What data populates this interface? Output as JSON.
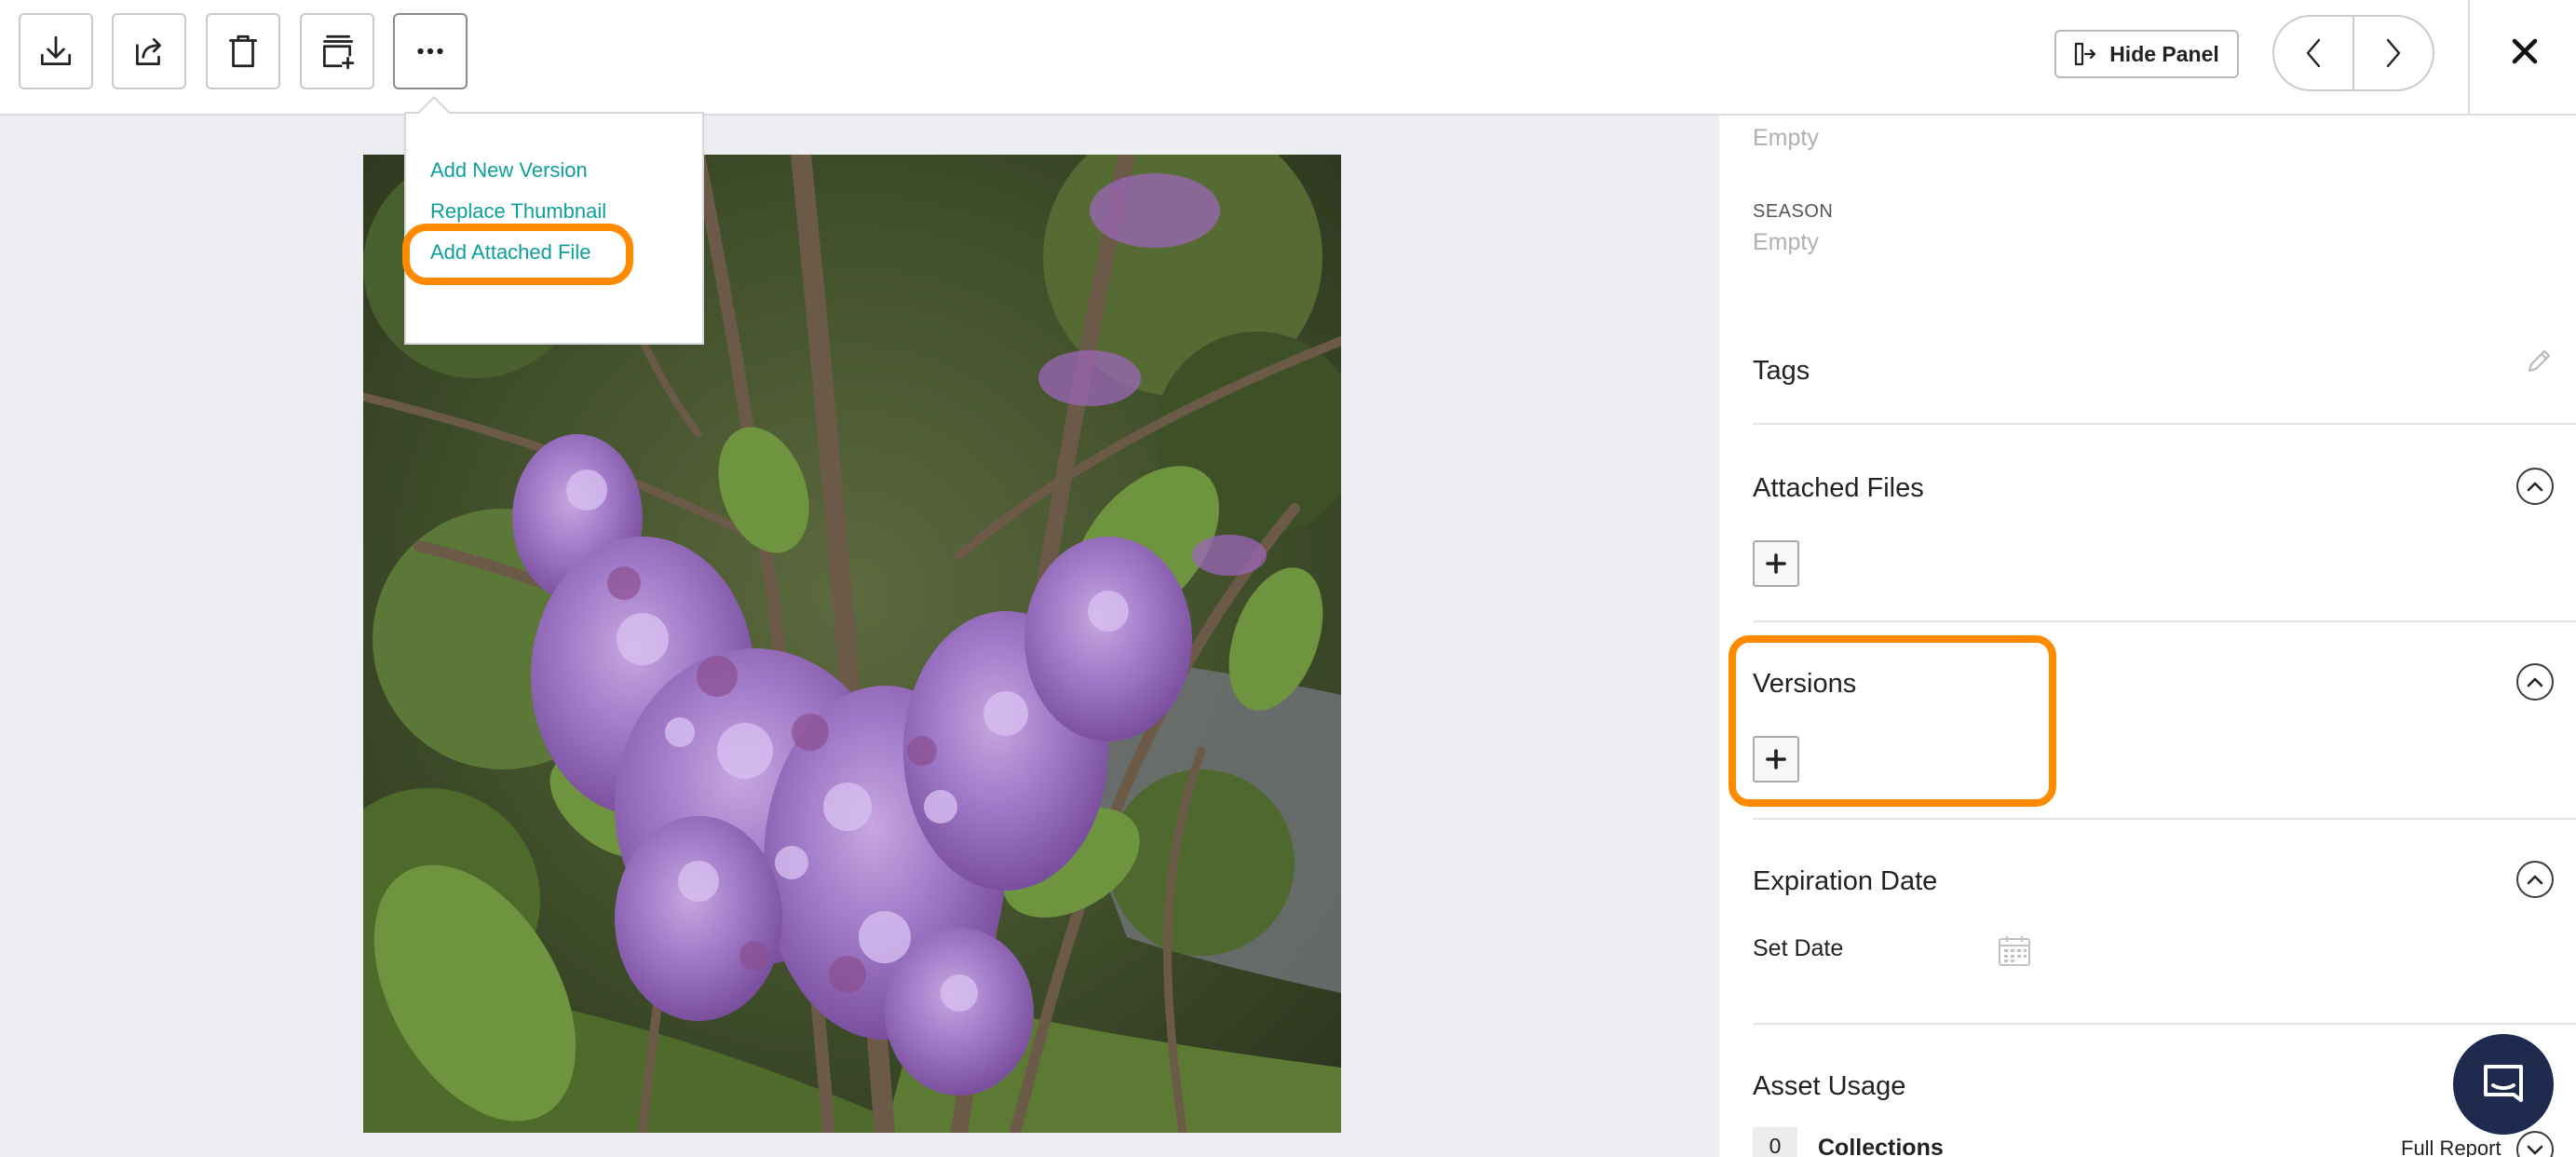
{
  "toolbar": {
    "icons": [
      "download-icon",
      "share-icon",
      "trash-icon",
      "add-to-collection-icon",
      "more-icon"
    ],
    "hide_panel_label": "Hide Panel",
    "hide_panel_icon": "panel-toggle-icon",
    "prev_icon": "chevron-left-icon",
    "next_icon": "chevron-right-icon",
    "close_icon": "close-icon"
  },
  "more_menu": {
    "items": [
      {
        "label": "Add New Version"
      },
      {
        "label": "Replace Thumbnail"
      },
      {
        "label": "Add Attached File",
        "highlighted": true
      }
    ]
  },
  "preview": {
    "subject": "lilac blossoms",
    "icon": "photo"
  },
  "panel": {
    "top_field": {
      "value": "Empty"
    },
    "season": {
      "label": "SEASON",
      "value": "Empty"
    },
    "tags": {
      "title": "Tags",
      "icon": "pencil-icon"
    },
    "attached_files": {
      "title": "Attached Files",
      "add_icon": "plus-icon",
      "toggle_icon": "chevron-up-icon"
    },
    "versions": {
      "title": "Versions",
      "add_icon": "plus-icon",
      "toggle_icon": "chevron-up-icon",
      "highlighted": true
    },
    "expiration_date": {
      "title": "Expiration Date",
      "set_date_label": "Set Date",
      "icon": "calendar-icon",
      "toggle_icon": "chevron-up-icon"
    },
    "asset_usage": {
      "title": "Asset Usage",
      "collections_count": "0",
      "collections_label": "Collections",
      "full_report_label": "Full Report",
      "toggle_icon": "chevron-down-icon"
    }
  },
  "chat": {
    "icon": "chat-bubble-icon"
  },
  "colors": {
    "accent_link": "#0d9f9b",
    "highlight": "#ff8a00",
    "chat_button": "#1e2a4e",
    "canvas_background": "#edeef1"
  }
}
